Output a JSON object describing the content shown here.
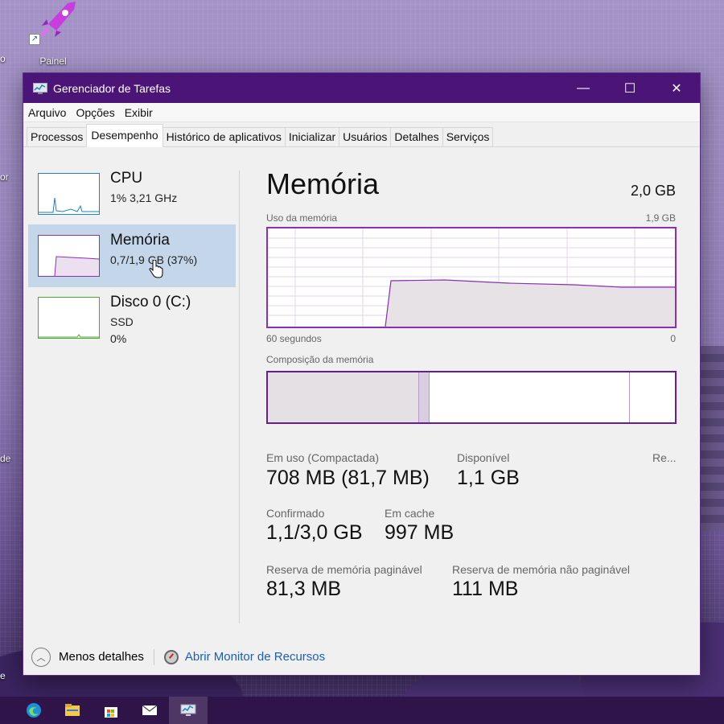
{
  "desktop": {
    "icon_label": "Painel",
    "edge_texts": [
      "o",
      "or",
      "de",
      "e"
    ]
  },
  "window": {
    "title": "Gerenciador de Tarefas",
    "controls": {
      "minimize": "—",
      "maximize": "☐",
      "close": "✕"
    }
  },
  "menu": [
    "Arquivo",
    "Opções",
    "Exibir"
  ],
  "tabs": [
    {
      "label": "Processos",
      "active": false
    },
    {
      "label": "Desempenho",
      "active": true
    },
    {
      "label": "Histórico de aplicativos",
      "active": false
    },
    {
      "label": "Inicializar",
      "active": false
    },
    {
      "label": "Usuários",
      "active": false
    },
    {
      "label": "Detalhes",
      "active": false
    },
    {
      "label": "Serviços",
      "active": false
    }
  ],
  "sidebar": [
    {
      "title": "CPU",
      "line1": "1%  3,21 GHz",
      "line2": "",
      "color": "#1a82c4",
      "selected": false
    },
    {
      "title": "Memória",
      "line1": "0,7/1,9 GB (37%)",
      "line2": "",
      "color": "#8b2fb3",
      "selected": true
    },
    {
      "title": "Disco 0 (C:)",
      "line1": "SSD",
      "line2": "0%",
      "color": "#4da832",
      "selected": false
    }
  ],
  "main": {
    "title": "Memória",
    "total": "2,0 GB",
    "usage_label": "Uso da memória",
    "usage_max": "1,9 GB",
    "time_left": "60 segundos",
    "time_right": "0",
    "composition_label": "Composição da memória",
    "stats": {
      "in_use_label": "Em uso (Compactada)",
      "in_use_value": "708 MB (81,7 MB)",
      "available_label": "Disponível",
      "available_value": "1,1 GB",
      "reserved_label": "Re...",
      "committed_label": "Confirmado",
      "committed_value": "1,1/3,0 GB",
      "cached_label": "Em cache",
      "cached_value": "997 MB",
      "paged_label": "Reserva de memória paginável",
      "paged_value": "81,3 MB",
      "nonpaged_label": "Reserva de memória não paginável",
      "nonpaged_value": "111 MB"
    }
  },
  "footer": {
    "less_details": "Menos detalhes",
    "resource_monitor": "Abrir Monitor de Recursos"
  },
  "taskbar": [
    "edge-icon",
    "file-explorer-icon",
    "store-icon",
    "mail-icon",
    "task-manager-icon"
  ],
  "colors": {
    "accent": "#4b1477",
    "memory": "#8b2fb3",
    "link": "#1a5fb4"
  }
}
